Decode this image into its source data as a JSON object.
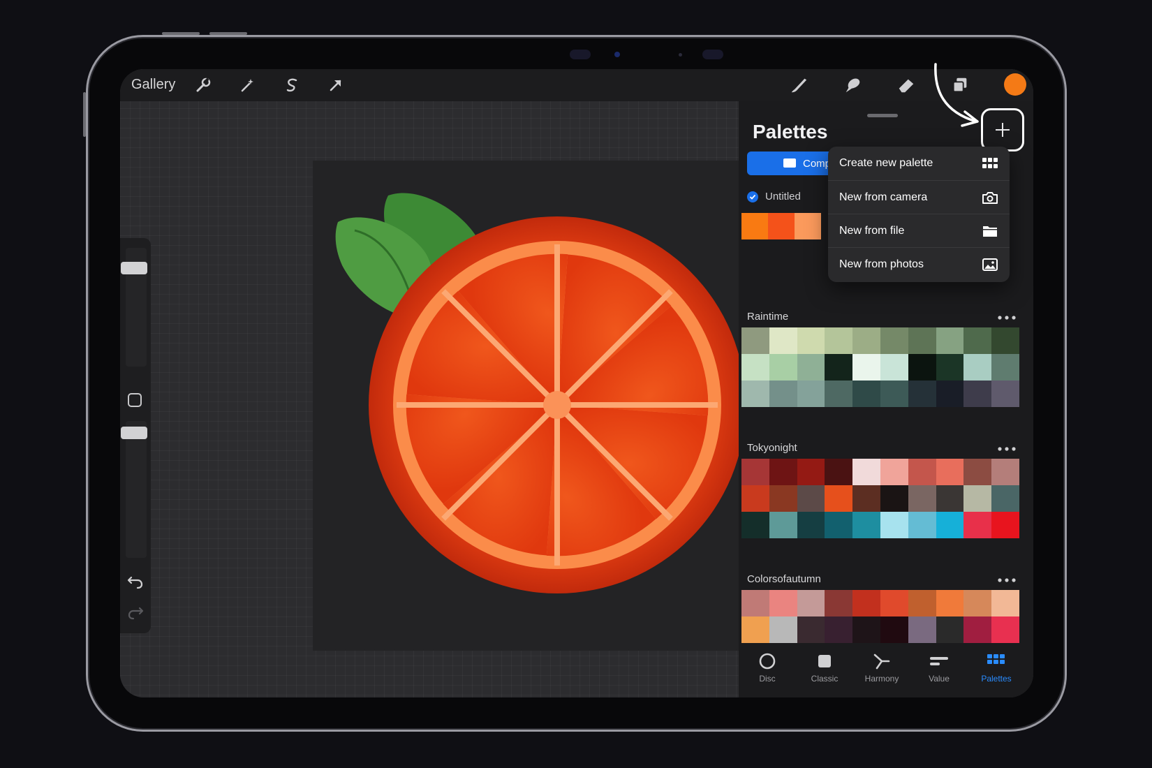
{
  "toolbar": {
    "gallery_label": "Gallery",
    "left_tools": [
      "wrench-icon",
      "magic-wand-icon",
      "selection-icon",
      "transform-arrow-icon"
    ],
    "right_tools": [
      "brush-icon",
      "smudge-icon",
      "eraser-icon",
      "layers-icon"
    ],
    "current_color": "#f47a16"
  },
  "panel": {
    "title": "Palettes",
    "compact_label": "Comp",
    "default_palette": {
      "name": "Untitled",
      "swatches": [
        "#f97a12",
        "#f4521a",
        "#fb9a5c"
      ]
    }
  },
  "menu": {
    "items": [
      {
        "label": "Create new palette",
        "icon": "grid-icon"
      },
      {
        "label": "New from camera",
        "icon": "camera-icon"
      },
      {
        "label": "New from file",
        "icon": "folder-icon"
      },
      {
        "label": "New from photos",
        "icon": "photo-icon"
      }
    ]
  },
  "palettes": [
    {
      "name": "Raintime",
      "swatches": [
        "#8f9a7f",
        "#dfe7c6",
        "#cfdaae",
        "#b4c59a",
        "#9cad86",
        "#758968",
        "#5e7456",
        "#86a282",
        "#4f6a4c",
        "#33482f",
        "#c6e1c4",
        "#a8cfa5",
        "#8fb096",
        "#13241b",
        "#eaf5ec",
        "#c9e4d8",
        "#0b140f",
        "#1b3526",
        "#a9cdc2",
        "#5f7c6f",
        "#9fb8ad",
        "#74908a",
        "#84a29a",
        "#4e6963",
        "#2f4a48",
        "#3d5a57",
        "#253138",
        "#191d27",
        "#3e3c4b",
        "#5f5a6c"
      ]
    },
    {
      "name": "Tokyonight",
      "swatches": [
        "#a63636",
        "#6e1414",
        "#941a14",
        "#4a1212",
        "#f1dada",
        "#f0a49a",
        "#c4564c",
        "#e86e5c",
        "#8c4c42",
        "#b47e7a",
        "#c93a1e",
        "#8a3822",
        "#5c4a48",
        "#e6501c",
        "#5c2e22",
        "#1a1414",
        "#7a6662",
        "#3a3634",
        "#b6b8a4",
        "#4a6666",
        "#142e2a",
        "#5e9a98",
        "#153e42",
        "#12606e",
        "#1e8ea0",
        "#a7e2ee",
        "#64bcd4",
        "#16b0d8",
        "#e8304a",
        "#e8141e"
      ]
    },
    {
      "name": "Colorsofautumn",
      "swatches": [
        "#c07a76",
        "#ea8480",
        "#c49a98",
        "#8a3834",
        "#c2301e",
        "#e04a2c",
        "#c0602e",
        "#f07a3a",
        "#d6885a",
        "#f2b896"
      ],
      "under_strip": [
        "#f0a050",
        "#b8b8b8",
        "#3a2a30",
        "#382030",
        "#1e1418",
        "#200a10",
        "#7a6a80",
        "#2a2a2a",
        "#a01e40",
        "#e83050"
      ]
    }
  ],
  "tabs": [
    {
      "label": "Disc",
      "icon": "disc-icon"
    },
    {
      "label": "Classic",
      "icon": "classic-square-icon"
    },
    {
      "label": "Harmony",
      "icon": "harmony-icon"
    },
    {
      "label": "Value",
      "icon": "value-sliders-icon"
    },
    {
      "label": "Palettes",
      "icon": "palettes-grid-icon",
      "active": true
    }
  ]
}
